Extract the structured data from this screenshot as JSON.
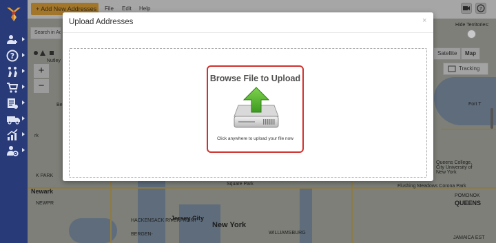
{
  "toolbar": {
    "add_button_label": "+ Add New Addresses",
    "menu": [
      "File",
      "Edit",
      "Help"
    ]
  },
  "sidebar": {
    "items": [
      {
        "icon": "add-user-icon"
      },
      {
        "icon": "help-icon"
      },
      {
        "icon": "routes-icon"
      },
      {
        "icon": "cart-icon"
      },
      {
        "icon": "orders-icon"
      },
      {
        "icon": "vehicles-icon"
      },
      {
        "icon": "analytics-icon"
      },
      {
        "icon": "settings-user-icon"
      }
    ]
  },
  "map": {
    "search_placeholder": "Search in Ac",
    "zoom_in": "+",
    "zoom_out": "−",
    "satellite_label": "Satellite",
    "map_label": "Map",
    "tracking_label": "Tracking",
    "hide_territories_label": "Hide Territories:",
    "labels": {
      "nutley": "Nutley",
      "newark": "Newark",
      "jersey_city": "Jersey City",
      "new_york": "New York",
      "queens": "QUEENS",
      "fort_totten": "Fort T",
      "queens_college": "Queens College, City University of New York",
      "square_park": "Square Park",
      "flushing_meadows": "Flushing Meadows Corona Park",
      "williamsburg": "WILLIAMSBURG",
      "be": "Be",
      "rk": "rk",
      "newpr": "NEWPR",
      "hackensack": "HACKENSACK RIVERFRONT",
      "bergen": "BERGEN-",
      "k_park": "K PARK",
      "pomonok": "POMONOK",
      "jamaica": "JAMAICA EST"
    }
  },
  "modal": {
    "title": "Upload Addresses",
    "close": "×",
    "upload_title": "Browse File to Upload",
    "upload_caption": "Click anywhere to upload your file now"
  },
  "colors": {
    "sidebar": "#293a78",
    "accent_button": "#a3772b",
    "highlight_border": "#d0312d",
    "upload_arrow": "#4caf29"
  }
}
